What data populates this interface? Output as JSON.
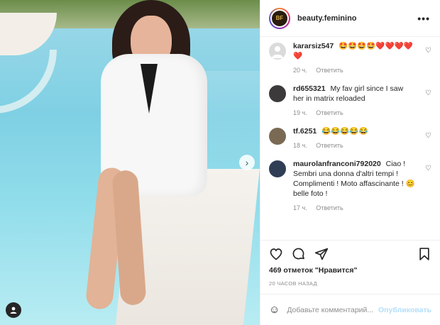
{
  "post": {
    "account": "beauty.feminino",
    "avatar_initials": "BF",
    "more_icon": "more-horizontal-icon"
  },
  "comments": [
    {
      "user": "kararsiz547",
      "text": "🤩🤩🤩🤩❤️❤️❤️❤️❤️",
      "time": "20 ч.",
      "reply": "Ответить"
    },
    {
      "user": "rd655321",
      "text": "My fav girl since I saw her in matrix reloaded",
      "time": "19 ч.",
      "reply": "Ответить"
    },
    {
      "user": "tf.6251",
      "text": "😂😂😂😂😂",
      "time": "18 ч.",
      "reply": "Ответить"
    },
    {
      "user": "maurolanfranconi792020",
      "text": "Ciao ! Sembri una donna d'altri tempi ! Complimenti ! Moto affascinante ! 😊 belle foto !",
      "time": "17 ч.",
      "reply": "Ответить"
    }
  ],
  "likes": "469 отметок \"Нравится\"",
  "time_ago": "20 ЧАСОВ НАЗАД",
  "add_comment": {
    "placeholder": "Добавьте комментарий...",
    "publish": "Опубликовать"
  },
  "colors": {
    "link_blue": "#b2dffc",
    "meta_gray": "#8e8e8e",
    "text": "#262626"
  }
}
